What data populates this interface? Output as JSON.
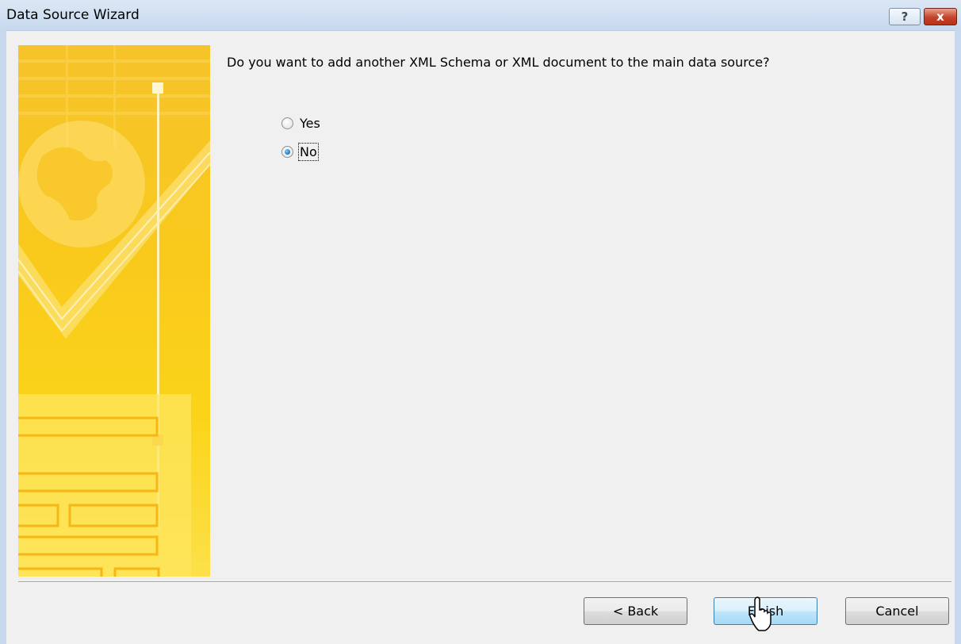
{
  "window": {
    "title": "Data Source Wizard",
    "help_label": "?",
    "close_label": "x"
  },
  "content": {
    "question": "Do you want to add another XML Schema or XML document to the main data source?",
    "options": [
      {
        "label": "Yes",
        "selected": false
      },
      {
        "label": "No",
        "selected": true
      }
    ]
  },
  "buttons": {
    "back": "< Back",
    "finish": "Finish",
    "cancel": "Cancel"
  },
  "colors": {
    "banner": "#f9c91c",
    "titlebar": "#c8d9ee",
    "primary_button": "#bee6fd"
  }
}
